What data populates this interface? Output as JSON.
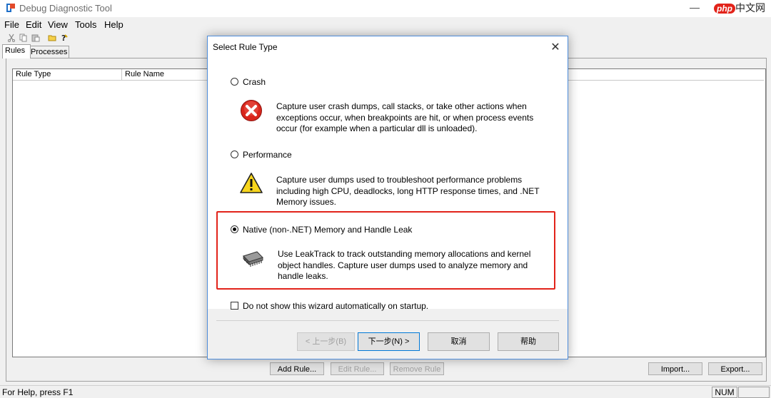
{
  "app": {
    "title": "Debug Diagnostic Tool",
    "minimize_glyph": "—",
    "watermark_php": "php",
    "watermark_cn": "中文网"
  },
  "menu": [
    "File",
    "Edit",
    "View",
    "Tools",
    "Help"
  ],
  "tabs": {
    "rules": "Rules",
    "processes": "Processes"
  },
  "list": {
    "columns": [
      "Rule Type",
      "Rule Name"
    ]
  },
  "bottom_buttons": {
    "add_rule": "Add Rule...",
    "edit_rule": "Edit Rule...",
    "remove_rule": "Remove Rule",
    "import": "Import...",
    "export": "Export..."
  },
  "status": {
    "help": "For Help, press F1",
    "num": "NUM"
  },
  "dialog": {
    "title": "Select Rule Type",
    "close_glyph": "✕",
    "options": [
      {
        "label": "Crash",
        "selected": false,
        "icon": "error-icon",
        "description": "Capture user crash dumps, call stacks, or take other actions when exceptions occur, when breakpoints are hit, or when process events occur (for example when a particular dll is unloaded)."
      },
      {
        "label": "Performance",
        "selected": false,
        "icon": "warning-icon",
        "description": "Capture user dumps used to troubleshoot performance problems including high CPU, deadlocks, long HTTP response times, and .NET Memory issues."
      },
      {
        "label": "Native (non-.NET) Memory and Handle Leak",
        "selected": true,
        "icon": "memory-chip-icon",
        "description": "Use LeakTrack to track outstanding memory allocations and kernel object handles. Capture user dumps used to analyze memory and handle leaks."
      }
    ],
    "checkbox_label": "Do not show this wizard automatically on startup.",
    "buttons": {
      "back": "< 上一步(B)",
      "next": "下一步(N) >",
      "cancel": "取消",
      "help": "帮助"
    }
  },
  "colors": {
    "highlight": "#e2231a",
    "dialog_border": "#4f8edc",
    "error_red": "#d9261c",
    "warning_yellow": "#f7d51d"
  }
}
